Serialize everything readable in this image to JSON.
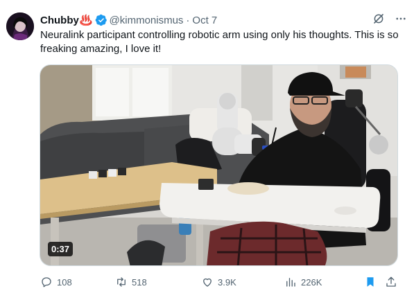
{
  "author": {
    "name": "Chubby",
    "name_emoji": "♨️",
    "handle": "@kimmonismus",
    "separator": "·",
    "time": "Oct 7"
  },
  "tweet": {
    "text": "Neuralink participant controlling robotic arm using only his thoughts. This is so freaking amazing, I love it!"
  },
  "media": {
    "duration": "0:37"
  },
  "actions": {
    "replies": "108",
    "reposts": "518",
    "likes": "3.9K",
    "views": "226K"
  },
  "colors": {
    "text": "#0f1419",
    "secondary": "#536471",
    "accent": "#1d9bf0",
    "verified": "#1d9bf0"
  },
  "icons": {
    "more": "more-icon",
    "grok": "grok-icon",
    "reply": "reply-icon",
    "repost": "repost-icon",
    "like": "like-icon",
    "views": "views-icon",
    "bookmark": "bookmark-icon",
    "share": "share-icon"
  }
}
